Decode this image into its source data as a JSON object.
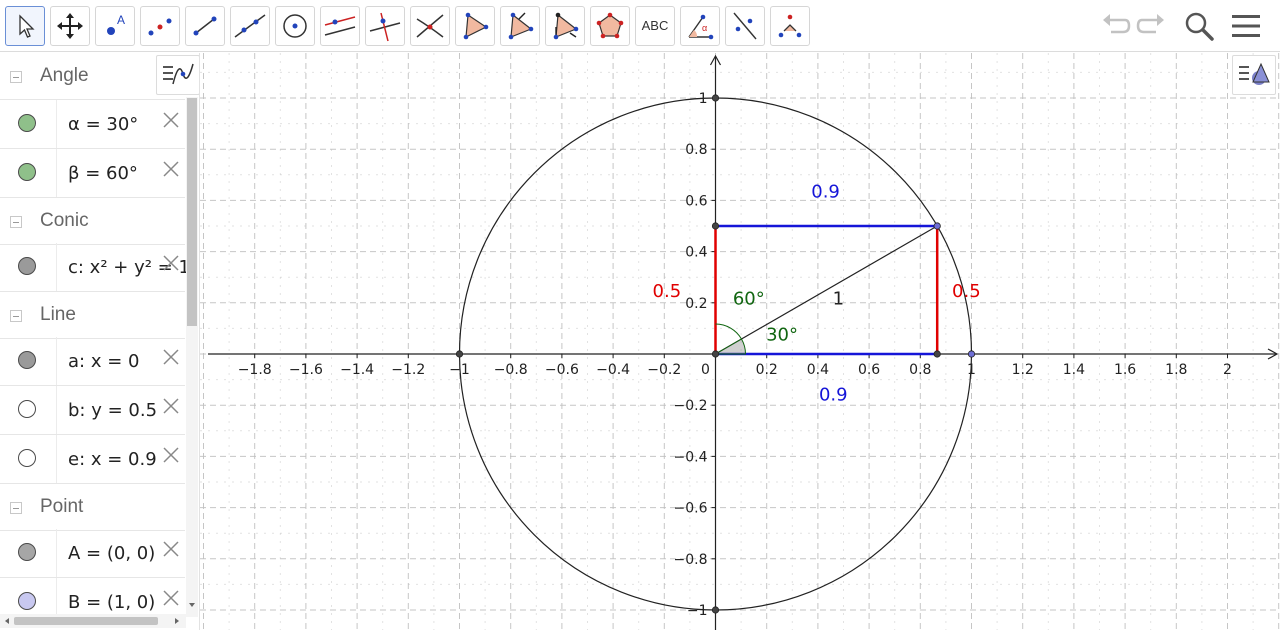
{
  "toolbar": {
    "tools": [
      {
        "name": "move-tool"
      },
      {
        "name": "move-graphics-view-tool"
      },
      {
        "name": "point-tool"
      },
      {
        "name": "point-on-object-tool"
      },
      {
        "name": "segment-tool"
      },
      {
        "name": "line-tool"
      },
      {
        "name": "circle-center-point-tool"
      },
      {
        "name": "parallel-line-tool"
      },
      {
        "name": "perpendicular-bisector-tool"
      },
      {
        "name": "intersect-tool"
      },
      {
        "name": "polygon-tool"
      },
      {
        "name": "vector-polygon-tool"
      },
      {
        "name": "rigid-polygon-tool"
      },
      {
        "name": "regular-polygon-tool"
      },
      {
        "name": "text-tool",
        "label": "ABC"
      },
      {
        "name": "angle-tool"
      },
      {
        "name": "reflect-about-line-tool"
      },
      {
        "name": "relation-tool"
      }
    ],
    "undo_icon": "undo-icon",
    "redo_icon": "redo-icon",
    "search_icon": "search-icon",
    "menu_icon": "menu-icon"
  },
  "algebra": {
    "groups": [
      {
        "label": "Angle",
        "items": [
          {
            "text": "α = 30°",
            "color": "#8fc08a"
          },
          {
            "text": "β = 60°",
            "color": "#8fc08a"
          }
        ]
      },
      {
        "label": "Conic",
        "items": [
          {
            "text": "c: x² + y² = 1",
            "color": "#9a9a9a"
          }
        ]
      },
      {
        "label": "Line",
        "items": [
          {
            "text": "a: x = 0",
            "color": "#9a9a9a"
          },
          {
            "text": "b: y = 0.5",
            "color": "#ffffff"
          },
          {
            "text": "e: x = 0.9",
            "color": "#ffffff"
          }
        ]
      },
      {
        "label": "Point",
        "items": [
          {
            "text": "A = (0, 0)",
            "color": "#a6a6a6"
          },
          {
            "text": "B = (1, 0)",
            "color": "#c8c8f0"
          }
        ]
      }
    ]
  },
  "graphics": {
    "x_ticks": [
      "−1.8",
      "−1.6",
      "−1.4",
      "−1.2",
      "−1",
      "−0.8",
      "−0.6",
      "−0.4",
      "−0.2",
      "0",
      "0.2",
      "0.4",
      "0.6",
      "0.8",
      "1",
      "1.2",
      "1.4",
      "1.6",
      "1.8",
      "2"
    ],
    "y_ticks_pos": [
      "0.2",
      "0.4",
      "0.6",
      "0.8",
      "1"
    ],
    "y_ticks_neg": [
      "−0.2",
      "−0.4",
      "−0.6",
      "−0.8",
      "−1"
    ],
    "labels": {
      "top_width": "0.9",
      "bottom_width": "0.9",
      "left_height": "0.5",
      "right_height": "0.5",
      "radius": "1",
      "angle_beta": "60°",
      "angle_alpha": "30°"
    },
    "colors": {
      "blue": "#1515d8",
      "red": "#e00000",
      "green": "#116611",
      "grid": "#c0c0c0"
    }
  }
}
